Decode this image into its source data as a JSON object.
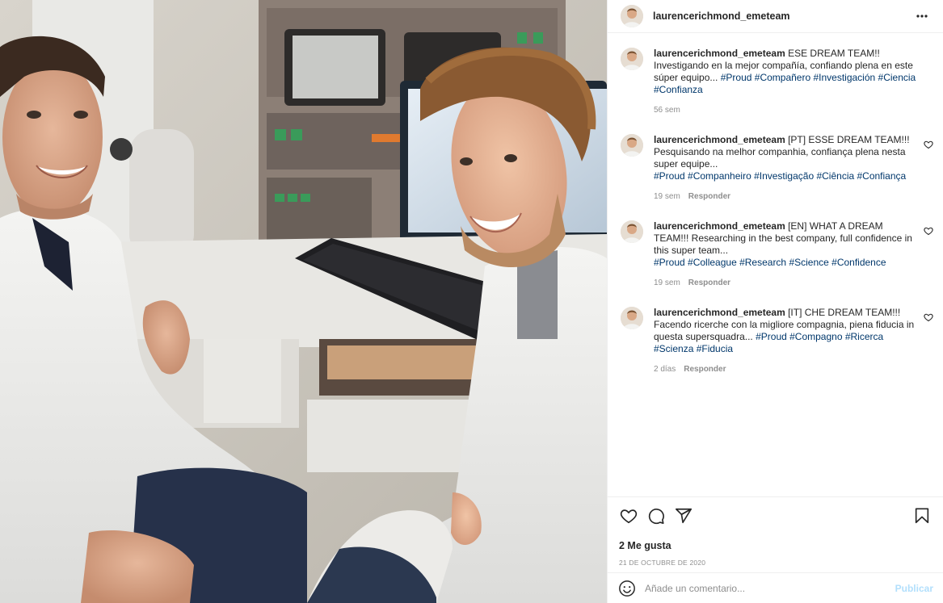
{
  "photo": {
    "alt_icon": "photo-lab-scientists"
  },
  "header": {
    "username": "laurencerichmond_emeteam",
    "more_icon": "more-horizontal-icon"
  },
  "comments": [
    {
      "username": "laurencerichmond_emeteam",
      "text": "ESE DREAM TEAM!! Investigando en la mejor compañía, confiando plena en este súper equipo...",
      "hashtags": "#Proud #Compañero #Investigación #Ciencia #Confianza",
      "time": "56 sem",
      "reply": "",
      "has_like": false
    },
    {
      "username": "laurencerichmond_emeteam",
      "text": "[PT] ESSE DREAM TEAM!!! Pesquisando na melhor companhia, confiança plena nesta super equipe...",
      "hashtags": "#Proud #Companheiro #Investigação #Ciência #Confiança",
      "time": "19 sem",
      "reply": "Responder",
      "has_like": true
    },
    {
      "username": "laurencerichmond_emeteam",
      "text": "[EN] WHAT A DREAM TEAM!!! Researching in the best company, full confidence in this super team...",
      "hashtags": "#Proud #Colleague #Research #Science #Confidence",
      "time": "19 sem",
      "reply": "Responder",
      "has_like": true
    },
    {
      "username": "laurencerichmond_emeteam",
      "text": "[IT] CHE DREAM TEAM!!! Facendo ricerche con la migliore compagnia, piena fiducia in questa supersquadra...",
      "hashtags": "#Proud #Compagno #Ricerca #Scienza #Fiducia",
      "time": "2 días",
      "reply": "Responder",
      "has_like": true
    }
  ],
  "actions": {
    "like_icon": "heart-icon",
    "comment_icon": "comment-icon",
    "share_icon": "send-icon",
    "save_icon": "bookmark-icon"
  },
  "likes": "2 Me gusta",
  "date": "21 DE OCTUBRE DE 2020",
  "add_comment": {
    "emoji_icon": "emoji-icon",
    "placeholder": "Añade un comentario...",
    "publish_label": "Publicar"
  },
  "colors": {
    "hashtag": "#00376b",
    "meta": "#8e8e8e",
    "publish": "#b2dffc"
  }
}
